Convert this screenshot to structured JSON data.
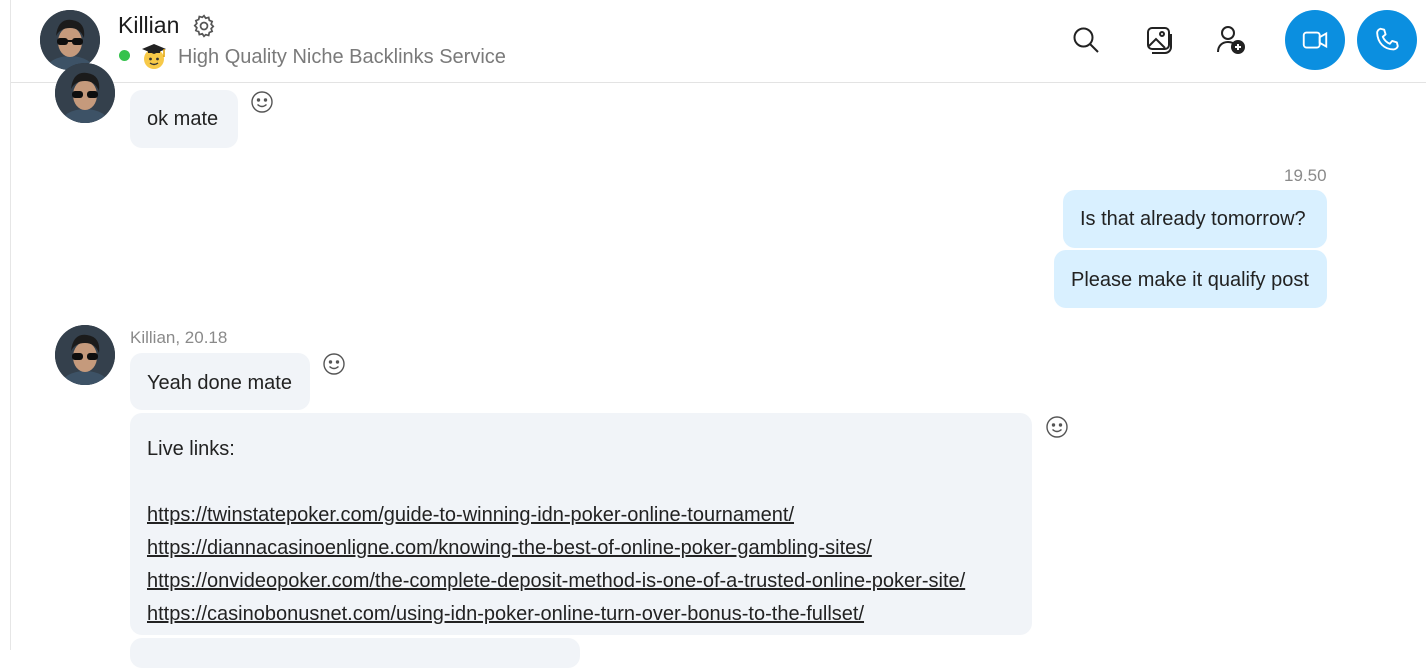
{
  "header": {
    "contact_name": "Killian",
    "mood_message": "High Quality Niche Backlinks Service",
    "icons": {
      "settings": "gear-icon",
      "search": "search-icon",
      "gallery": "gallery-icon",
      "add_people": "add-people-icon",
      "video_call": "video-camera-icon",
      "audio_call": "phone-icon"
    },
    "colors": {
      "call_button": "#0b8fe0",
      "presence_online": "#35c24c"
    }
  },
  "messages": {
    "m1": {
      "text": "ok mate"
    },
    "m2_time": "19.50",
    "m2": {
      "text": "Is that already tomorrow?"
    },
    "m3": {
      "text": "Please make it qualify post"
    },
    "m4_meta": "Killian, 20.18",
    "m4": {
      "text": "Yeah done mate"
    },
    "m5": {
      "heading": "Live links:",
      "links": [
        "https://twinstatepoker.com/guide-to-winning-idn-poker-online-tournament/",
        "https://diannacasinoenligne.com/knowing-the-best-of-online-poker-gambling-sites/",
        "https://onvideopoker.com/the-complete-deposit-method-is-one-of-a-trusted-online-poker-site/",
        "https://casinobonusnet.com/using-idn-poker-online-turn-over-bonus-to-the-fullset/"
      ]
    },
    "colors": {
      "incoming_bubble": "#f1f4f8",
      "outgoing_bubble": "#d9f0ff"
    }
  }
}
